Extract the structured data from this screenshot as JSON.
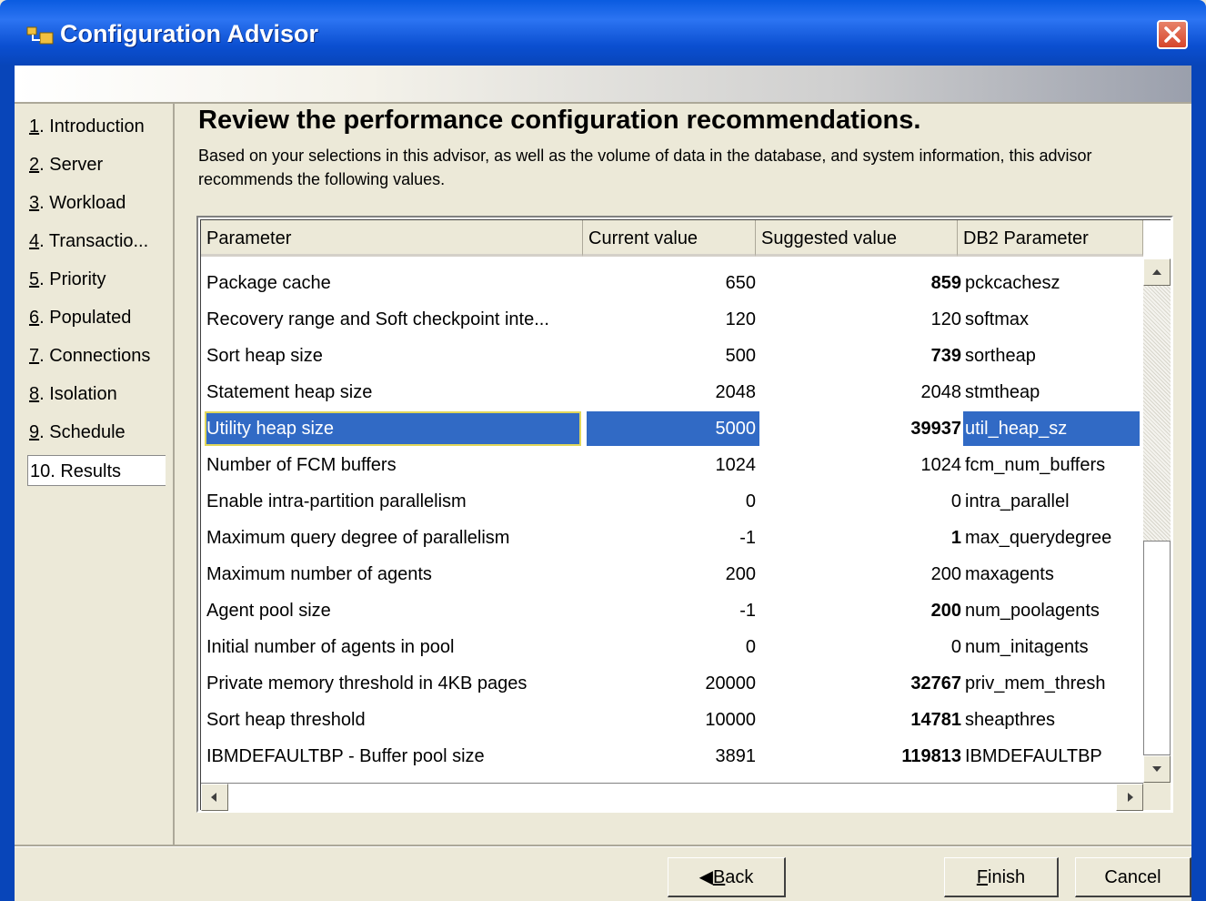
{
  "window": {
    "title": "Configuration Advisor",
    "accent": "#0a5be0",
    "close_icon": "close-icon"
  },
  "sidebar": {
    "items": [
      {
        "num": "1",
        "rest": ". Introduction"
      },
      {
        "num": "2",
        "rest": ". Server"
      },
      {
        "num": "3",
        "rest": ". Workload"
      },
      {
        "num": "4",
        "rest": ". Transactio..."
      },
      {
        "num": "5",
        "rest": ". Priority"
      },
      {
        "num": "6",
        "rest": ". Populated"
      },
      {
        "num": "7",
        "rest": ". Connections"
      },
      {
        "num": "8",
        "rest": ". Isolation"
      },
      {
        "num": "9",
        "rest": ". Schedule"
      },
      {
        "num": "10. Results",
        "rest": ""
      }
    ],
    "selected": "10. Results"
  },
  "main": {
    "heading": "Review the performance configuration recommendations.",
    "description": "Based on your selections in this advisor, as well as the volume of data in the database, and system information, this advisor recommends the following values."
  },
  "table": {
    "columns": [
      "Parameter",
      "Current value",
      "Suggested value",
      "DB2 Parameter"
    ],
    "rows": [
      {
        "param": "Package cache",
        "current": "650",
        "suggested": "859",
        "db2": "pckcachesz",
        "bold": true
      },
      {
        "param": "Recovery range and Soft checkpoint inte...",
        "current": "120",
        "suggested": "120",
        "db2": "softmax",
        "bold": false
      },
      {
        "param": "Sort heap size",
        "current": "500",
        "suggested": "739",
        "db2": "sortheap",
        "bold": true
      },
      {
        "param": "Statement heap size",
        "current": "2048",
        "suggested": "2048",
        "db2": "stmtheap",
        "bold": false
      },
      {
        "param": "Utility heap size",
        "current": "5000",
        "suggested": "39937",
        "db2": "util_heap_sz",
        "bold": true,
        "selected": true
      },
      {
        "param": "Number of FCM buffers",
        "current": "1024",
        "suggested": "1024",
        "db2": "fcm_num_buffers",
        "bold": false
      },
      {
        "param": "Enable intra-partition parallelism",
        "current": "0",
        "suggested": "0",
        "db2": "intra_parallel",
        "bold": false
      },
      {
        "param": "Maximum query degree of parallelism",
        "current": "-1",
        "suggested": "1",
        "db2": "max_querydegree",
        "bold": true
      },
      {
        "param": "Maximum number of agents",
        "current": "200",
        "suggested": "200",
        "db2": "maxagents",
        "bold": false
      },
      {
        "param": "Agent pool size",
        "current": "-1",
        "suggested": "200",
        "db2": "num_poolagents",
        "bold": true
      },
      {
        "param": "Initial number of agents in pool",
        "current": "0",
        "suggested": "0",
        "db2": "num_initagents",
        "bold": false
      },
      {
        "param": "Private memory threshold in 4KB pages",
        "current": "20000",
        "suggested": "32767",
        "db2": "priv_mem_thresh",
        "bold": true
      },
      {
        "param": "Sort heap threshold",
        "current": "10000",
        "suggested": "14781",
        "db2": "sheapthres",
        "bold": true
      },
      {
        "param": "IBMDEFAULTBP - Buffer pool size",
        "current": "3891",
        "suggested": "119813",
        "db2": "IBMDEFAULTBP",
        "bold": true
      }
    ]
  },
  "buttons": {
    "back": {
      "mnemonic": "B",
      "rest": "ack"
    },
    "finish": {
      "mnemonic": "F",
      "rest": "inish"
    },
    "cancel": "Cancel"
  }
}
